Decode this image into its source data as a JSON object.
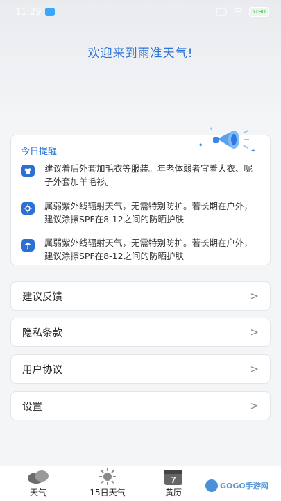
{
  "status_bar": {
    "time": "11:29",
    "battery_label": "51HD"
  },
  "header": {
    "welcome": "欢迎来到雨准天气!"
  },
  "reminder": {
    "title": "今日提醒",
    "tips": [
      {
        "icon": "shirt-icon",
        "text": "建议着后外套加毛衣等服装。年老体弱者宜着大衣、呢子外套加羊毛衫。"
      },
      {
        "icon": "sun-icon",
        "text": "属弱紫外线辐射天气，无需特别防护。若长期在户外，建议涂擦SPF在8-12之间的防晒护肤"
      },
      {
        "icon": "umbrella-icon",
        "text": "属弱紫外线辐射天气，无需特别防护。若长期在户外，建议涂擦SPF在8-12之间的防晒护肤"
      }
    ]
  },
  "menu": [
    {
      "label": "建议反馈",
      "chevron": ">"
    },
    {
      "label": "隐私条款",
      "chevron": ">"
    },
    {
      "label": "用户协议",
      "chevron": ">"
    },
    {
      "label": "设置",
      "chevron": ">"
    }
  ],
  "tabs": [
    {
      "label": "天气",
      "icon": "cloud-icon"
    },
    {
      "label": "15日天气",
      "icon": "sun-icon"
    },
    {
      "label": "黄历",
      "icon": "calendar-icon",
      "day": "7"
    }
  ],
  "watermark": {
    "text": "GOGO手游网"
  },
  "colors": {
    "accent": "#2a73d8",
    "icon_blue": "#2e6fd6"
  }
}
